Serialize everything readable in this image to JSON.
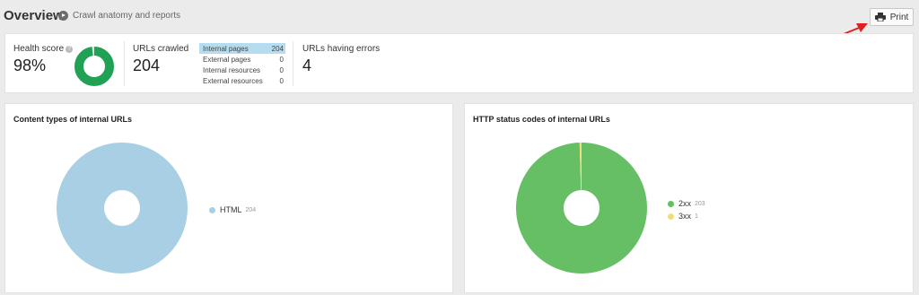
{
  "header": {
    "title": "Overview",
    "tour_label": "Crawl anatomy and reports",
    "print_label": "Print"
  },
  "summary": {
    "health": {
      "label": "Health score",
      "value": "98%",
      "score_fraction": 0.98,
      "help_glyph": "?"
    },
    "crawled": {
      "label": "URLs crawled",
      "value": "204"
    },
    "breakdown": [
      {
        "label": "Internal pages",
        "value": "204",
        "active": true
      },
      {
        "label": "External pages",
        "value": "0",
        "active": false
      },
      {
        "label": "Internal resources",
        "value": "0",
        "active": false
      },
      {
        "label": "External resources",
        "value": "0",
        "active": false
      }
    ],
    "errors": {
      "label": "URLs having errors",
      "value": "4"
    }
  },
  "content_types": {
    "title": "Content types of internal URLs",
    "chart_data": {
      "type": "pie",
      "title": "",
      "slices": [
        {
          "label": "HTML",
          "value": 204,
          "color": "#a8cfe3"
        }
      ]
    }
  },
  "status_codes": {
    "title": "HTTP status codes of internal URLs",
    "chart_data": {
      "type": "pie",
      "title": "",
      "slices": [
        {
          "label": "2xx",
          "value": 203,
          "color": "#66bf64"
        },
        {
          "label": "3xx",
          "value": 1,
          "color": "#f4dc7e"
        }
      ]
    }
  },
  "colors": {
    "health_ring": "#21a154",
    "health_ring_track": "#e6e6e6",
    "active_row": "#b6dcf0",
    "annotation_arrow": "#e02020"
  }
}
